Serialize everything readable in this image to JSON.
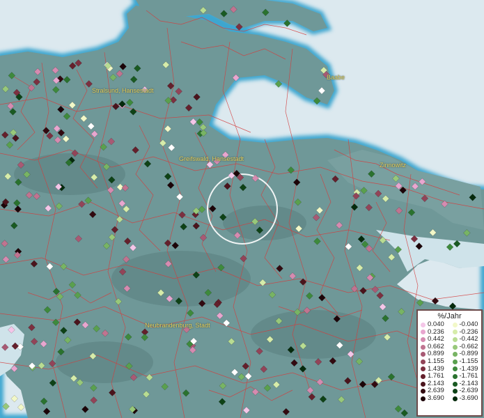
{
  "map": {
    "cities": [
      {
        "name": "Stralsund, Hansestadt"
      },
      {
        "name": "Baabe"
      },
      {
        "name": "Greifswald, Hansestadt"
      },
      {
        "name": "Zinnowitz"
      },
      {
        "name": "Neubrandenburg, Stadt"
      }
    ],
    "colors": {
      "land": "#6f9898",
      "water": "#dce9ef",
      "shore": "#3ea6cf",
      "borders": "#d43c3c",
      "selection_circle": "#ffffff",
      "label_text": "#e8d25a"
    }
  },
  "legend": {
    "title": "%/Jahr",
    "positive": [
      {
        "label": "0.040",
        "color": "#f4c6e8"
      },
      {
        "label": "0.236",
        "color": "#e8a6cf"
      },
      {
        "label": "0.442",
        "color": "#d58bb0"
      },
      {
        "label": "0.662",
        "color": "#c07490"
      },
      {
        "label": "0.899",
        "color": "#a85a74"
      },
      {
        "label": "1.155",
        "color": "#924458"
      },
      {
        "label": "1.439",
        "color": "#7c3040"
      },
      {
        "label": "1.761",
        "color": "#64202c"
      },
      {
        "label": "2.143",
        "color": "#4a141c"
      },
      {
        "label": "2.639",
        "color": "#320a10"
      },
      {
        "label": "3.690",
        "color": "#1c0408"
      }
    ],
    "negative": [
      {
        "label": "-0.040",
        "color": "#f2f8c8"
      },
      {
        "label": "-0.236",
        "color": "#d6ecaa"
      },
      {
        "label": "-0.442",
        "color": "#b8dc92"
      },
      {
        "label": "-0.662",
        "color": "#98c87a"
      },
      {
        "label": "-0.899",
        "color": "#78b464"
      },
      {
        "label": "-1.155",
        "color": "#5aa04e"
      },
      {
        "label": "-1.439",
        "color": "#3e8a3c"
      },
      {
        "label": "-1.761",
        "color": "#2a722e"
      },
      {
        "label": "-2.143",
        "color": "#1a5a22"
      },
      {
        "label": "-2.639",
        "color": "#0e4216"
      },
      {
        "label": "-3.690",
        "color": "#052a0c"
      }
    ]
  }
}
